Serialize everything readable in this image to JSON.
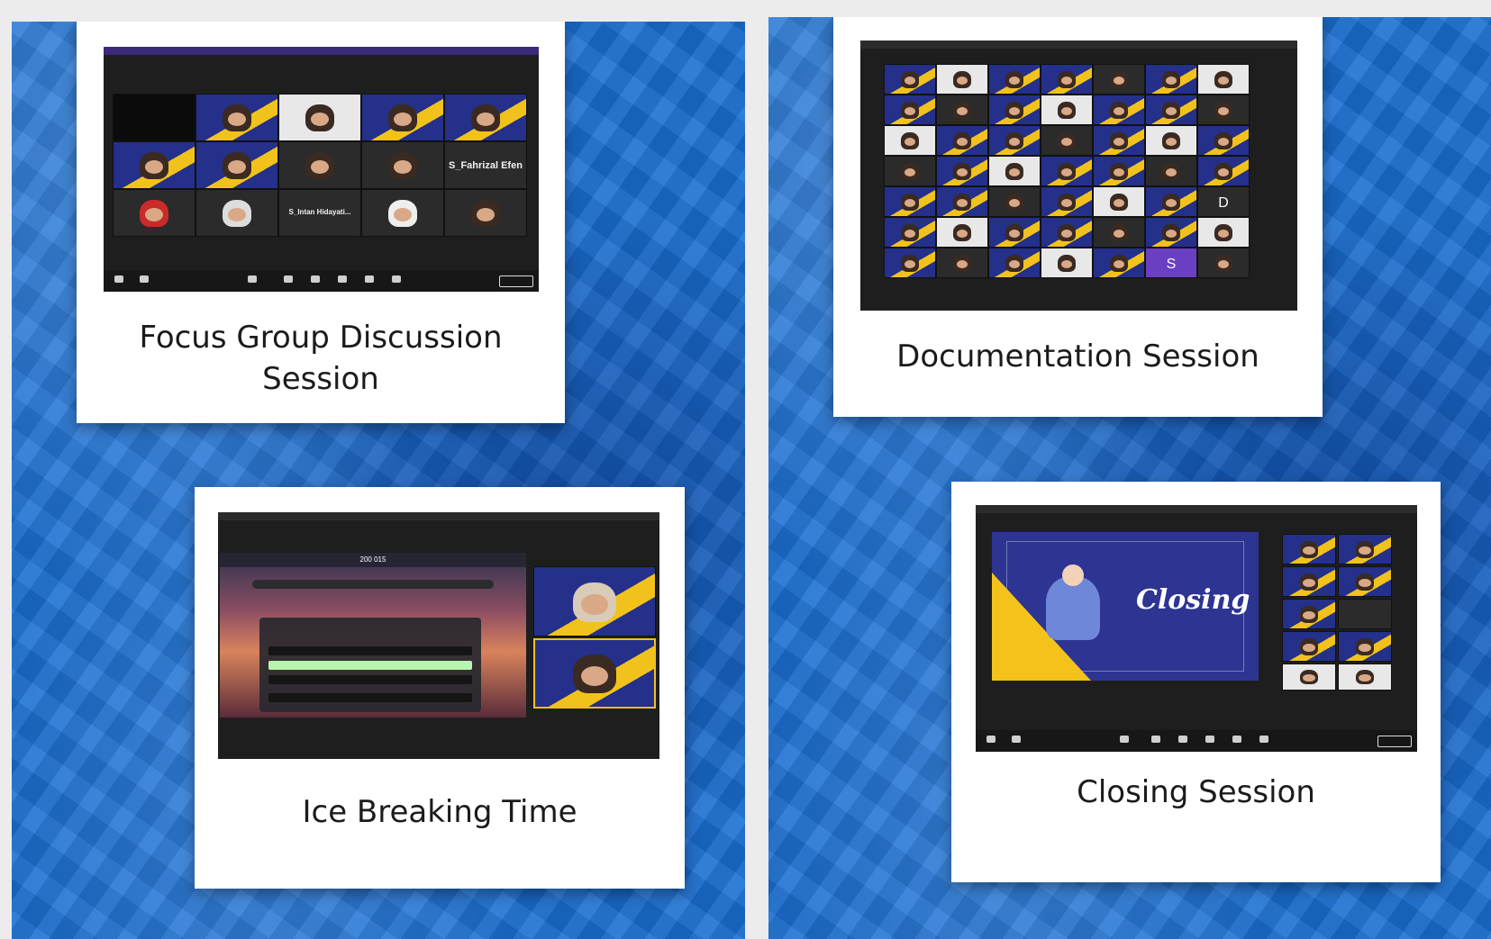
{
  "cards": {
    "fgd": {
      "caption_line1": "Focus Group Discussion",
      "caption_line2": "Session",
      "tile_names": [
        "S_Fahrizal Efendi",
        "S_Intan Hidayati..."
      ]
    },
    "documentation": {
      "caption": "Documentation Session",
      "tile_letters": [
        "D",
        "S"
      ]
    },
    "icebreak": {
      "caption": "Ice Breaking Time",
      "score": "200 015"
    },
    "closing": {
      "caption": "Closing Session",
      "slide_title": "Closing"
    }
  },
  "colors": {
    "background_blue": "#1a6fd3",
    "zoom_dark": "#1e1e1e",
    "accent_yellow": "#f1c21b",
    "slide_navy": "#2d3491"
  }
}
